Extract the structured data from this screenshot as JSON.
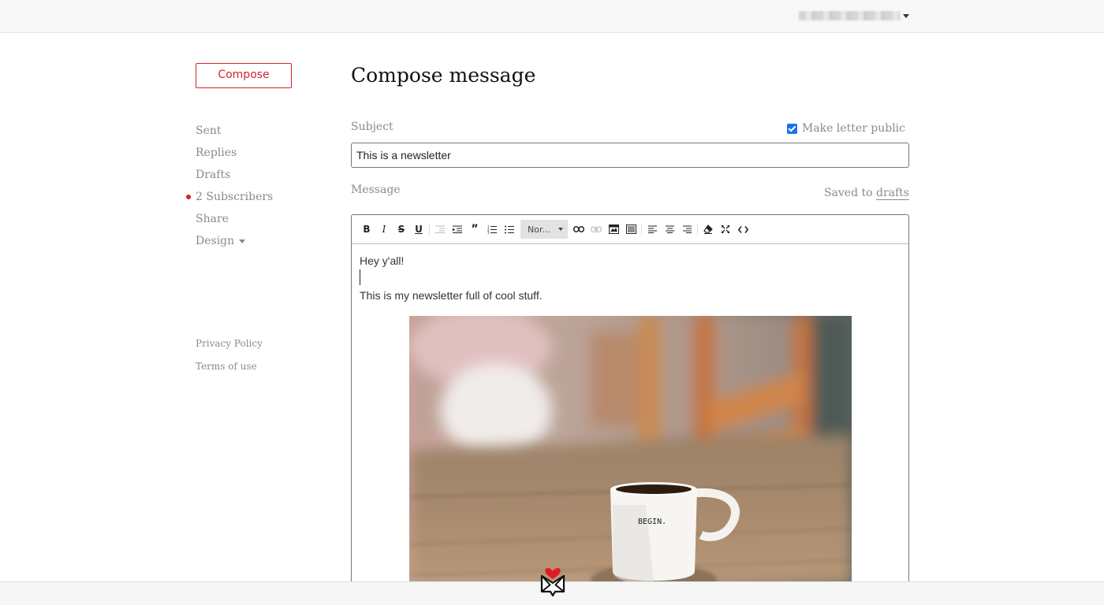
{
  "header": {
    "account_menu": "account-menu"
  },
  "sidebar": {
    "compose_label": "Compose",
    "nav": [
      {
        "label": "Sent"
      },
      {
        "label": "Replies"
      },
      {
        "label": "Drafts"
      },
      {
        "label": "2 Subscribers",
        "indicator_color": "#e01b24"
      },
      {
        "label": "Share"
      },
      {
        "label": "Design"
      }
    ],
    "footer": {
      "privacy": "Privacy Policy",
      "terms": "Terms of use"
    }
  },
  "main": {
    "title": "Compose message",
    "subject_label": "Subject",
    "make_public_label": "Make letter public",
    "make_public_checked": true,
    "subject_value": "This is a newsletter",
    "message_label": "Message",
    "saved_prefix": "Saved to",
    "saved_link": "drafts",
    "editor": {
      "format_value": "Nor...",
      "toolbar_icons": [
        "bold-icon",
        "italic-icon",
        "strikethrough-icon",
        "underline-icon",
        "outdent-icon",
        "indent-icon",
        "blockquote-icon",
        "ordered-list-icon",
        "bullet-list-icon",
        "format-select",
        "link-icon",
        "unlink-icon",
        "image-icon",
        "horizontal-rule-icon",
        "align-left-icon",
        "align-center-icon",
        "align-right-icon",
        "clear-format-icon",
        "fullscreen-icon",
        "code-view-icon"
      ],
      "line1": "Hey y'all!",
      "line2": "This is my newsletter full of cool stuff.",
      "image_mug_text": "BEGIN."
    }
  },
  "colors": {
    "accent": "#d3232f",
    "checkbox": "#1a73e8"
  }
}
